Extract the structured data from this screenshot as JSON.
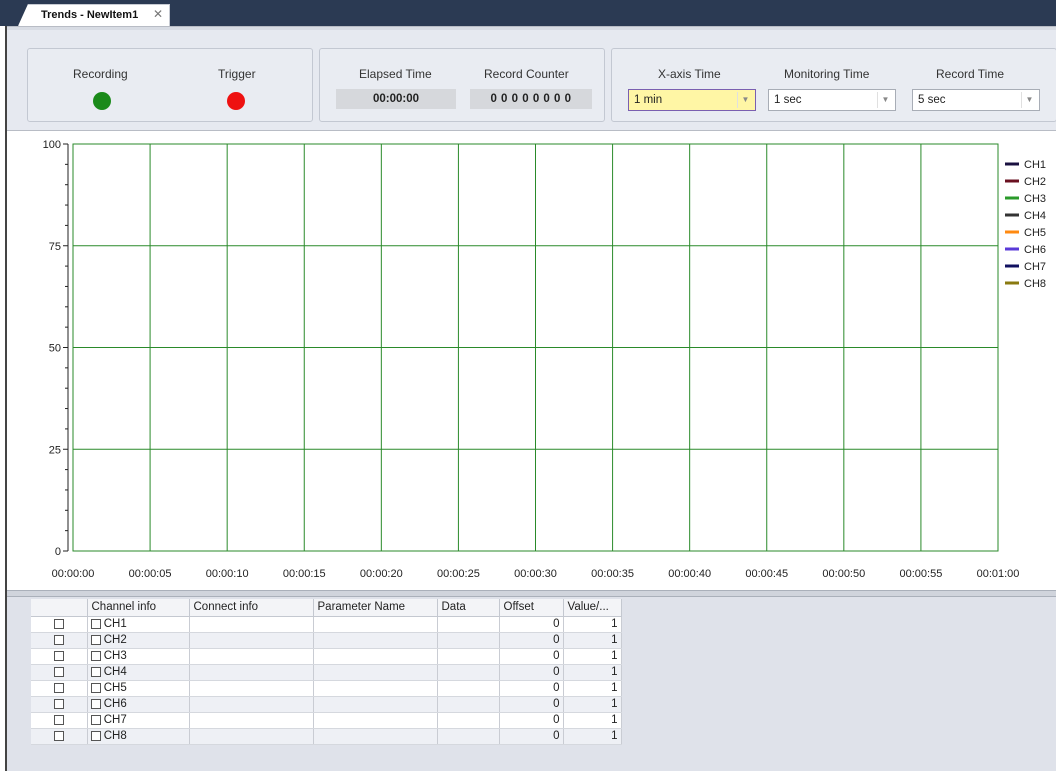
{
  "tab": {
    "title": "Trends - NewItem1",
    "close": "✕"
  },
  "status": {
    "recording_label": "Recording",
    "recording_color": "#1a8a1a",
    "trigger_label": "Trigger",
    "trigger_color": "#ee1111"
  },
  "counters": {
    "elapsed_label": "Elapsed Time",
    "elapsed_value": "00:00:00",
    "record_counter_label": "Record Counter",
    "record_counter_value": "0 0 0 0 0 0 0 0"
  },
  "settings": {
    "xaxis_label": "X-axis Time",
    "xaxis_value": "1 min",
    "monitoring_label": "Monitoring Time",
    "monitoring_value": "1 sec",
    "record_label": "Record Time",
    "record_value": "5 sec"
  },
  "chart_data": {
    "type": "line",
    "title": "",
    "xlabel": "",
    "ylabel": "",
    "ylim": [
      0,
      100
    ],
    "yticks": [
      "0",
      "25",
      "50",
      "75",
      "100"
    ],
    "x_ticks": [
      "00:00:00",
      "00:00:05",
      "00:00:10",
      "00:00:15",
      "00:00:20",
      "00:00:25",
      "00:00:30",
      "00:00:35",
      "00:00:40",
      "00:00:45",
      "00:00:50",
      "00:00:55",
      "00:01:00"
    ],
    "grid": true,
    "grid_color": "#2a8a2a",
    "legend_position": "right",
    "series": [
      {
        "name": "CH1",
        "color": "#1a1040",
        "values": []
      },
      {
        "name": "CH2",
        "color": "#6a1020",
        "values": []
      },
      {
        "name": "CH3",
        "color": "#2a9a2a",
        "values": []
      },
      {
        "name": "CH4",
        "color": "#333333",
        "values": []
      },
      {
        "name": "CH5",
        "color": "#ff8a10",
        "values": []
      },
      {
        "name": "CH6",
        "color": "#5a3ad8",
        "values": []
      },
      {
        "name": "CH7",
        "color": "#101060",
        "values": []
      },
      {
        "name": "CH8",
        "color": "#8a7a10",
        "values": []
      }
    ]
  },
  "table": {
    "columns": [
      "Channel info",
      "Connect info",
      "Parameter Name",
      "Data",
      "Offset",
      "Value/..."
    ],
    "rows": [
      {
        "channel": "CH1",
        "connect": "",
        "param": "",
        "data": "",
        "offset": "0",
        "value": "1"
      },
      {
        "channel": "CH2",
        "connect": "",
        "param": "",
        "data": "",
        "offset": "0",
        "value": "1"
      },
      {
        "channel": "CH3",
        "connect": "",
        "param": "",
        "data": "",
        "offset": "0",
        "value": "1"
      },
      {
        "channel": "CH4",
        "connect": "",
        "param": "",
        "data": "",
        "offset": "0",
        "value": "1"
      },
      {
        "channel": "CH5",
        "connect": "",
        "param": "",
        "data": "",
        "offset": "0",
        "value": "1"
      },
      {
        "channel": "CH6",
        "connect": "",
        "param": "",
        "data": "",
        "offset": "0",
        "value": "1"
      },
      {
        "channel": "CH7",
        "connect": "",
        "param": "",
        "data": "",
        "offset": "0",
        "value": "1"
      },
      {
        "channel": "CH8",
        "connect": "",
        "param": "",
        "data": "",
        "offset": "0",
        "value": "1"
      }
    ]
  }
}
